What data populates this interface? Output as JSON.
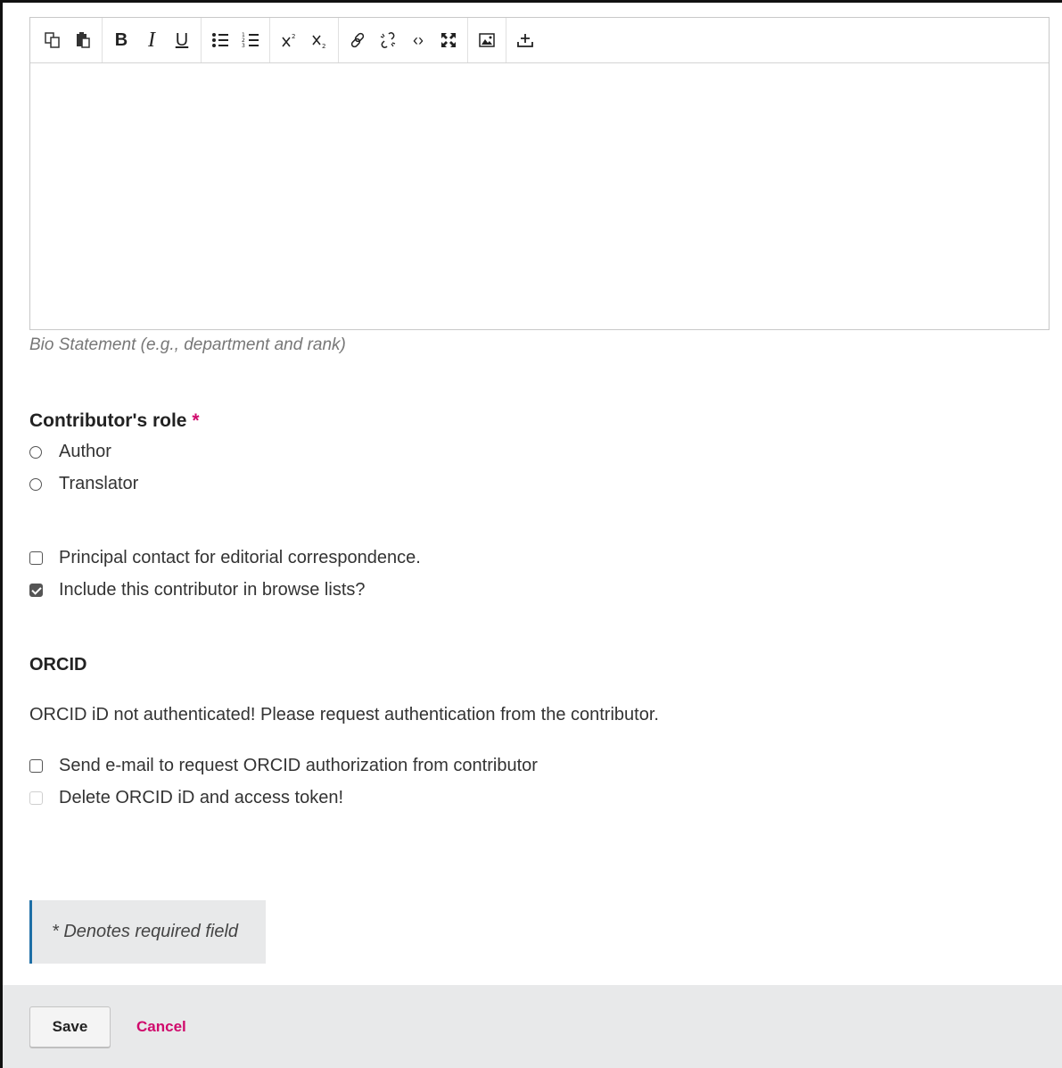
{
  "editor": {
    "toolbar": [
      {
        "name": "copy-icon"
      },
      {
        "name": "paste-icon"
      },
      {
        "name": "bold-icon",
        "glyph": "B"
      },
      {
        "name": "italic-icon",
        "glyph": "I"
      },
      {
        "name": "underline-icon",
        "glyph": "U"
      },
      {
        "name": "bullet-list-icon"
      },
      {
        "name": "numbered-list-icon"
      },
      {
        "name": "superscript-icon"
      },
      {
        "name": "subscript-icon"
      },
      {
        "name": "link-icon"
      },
      {
        "name": "unlink-icon"
      },
      {
        "name": "code-icon",
        "glyph": "‹›"
      },
      {
        "name": "fullscreen-icon"
      },
      {
        "name": "image-icon"
      },
      {
        "name": "upload-icon"
      }
    ],
    "hint": "Bio Statement (e.g., department and rank)"
  },
  "role": {
    "label": "Contributor's role",
    "required_mark": "*",
    "options": [
      "Author",
      "Translator"
    ]
  },
  "checks": {
    "principal_contact": "Principal contact for editorial correspondence.",
    "include_browse": "Include this contributor in browse lists?"
  },
  "orcid": {
    "heading": "ORCID",
    "message": "ORCID iD not authenticated! Please request authentication from the contributor.",
    "send_email": "Send e-mail to request ORCID authorization from contributor",
    "delete_token": "Delete ORCID iD and access token!"
  },
  "note": "* Denotes required field",
  "footer": {
    "save_label": "Save",
    "cancel_label": "Cancel"
  },
  "colors": {
    "accent": "#d00a6c",
    "note_border": "#1e6fa6"
  }
}
